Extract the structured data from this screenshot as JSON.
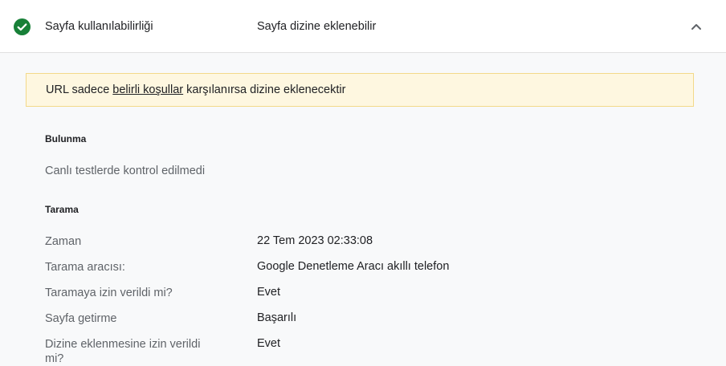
{
  "header": {
    "label": "Sayfa kullanılabilirliği",
    "value": "Sayfa dizine eklenebilir",
    "status_icon": "check-circle-icon",
    "status_color": "#188038",
    "toggle_icon": "chevron-up-icon"
  },
  "banner": {
    "prefix": "URL sadece ",
    "link": "belirli koşullar",
    "suffix": " karşılanırsa dizine eklenecektir",
    "background": "#fef7e0"
  },
  "discovery": {
    "title": "Bulunma",
    "note": "Canlı testlerde kontrol edilmedi"
  },
  "crawl": {
    "title": "Tarama",
    "rows": [
      {
        "label": "Zaman",
        "value": "22 Tem 2023 02:33:08"
      },
      {
        "label": "Tarama aracısı:",
        "value": "Google Denetleme Aracı akıllı telefon"
      },
      {
        "label": "Taramaya izin verildi mi?",
        "value": "Evet"
      },
      {
        "label": "Sayfa getirme",
        "value": "Başarılı"
      },
      {
        "label": "Dizine eklenmesine izin verildi mi?",
        "value": "Evet"
      }
    ]
  }
}
